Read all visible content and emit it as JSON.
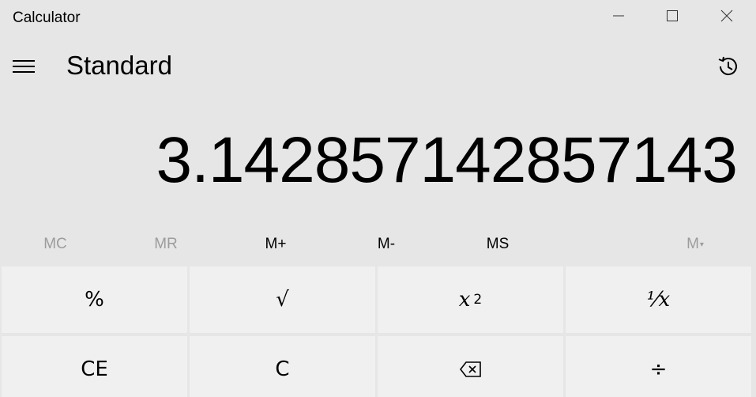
{
  "window": {
    "title": "Calculator"
  },
  "header": {
    "mode": "Standard"
  },
  "display": {
    "value": "3.142857142857143"
  },
  "memory": {
    "mc": "MC",
    "mr": "MR",
    "mplus": "M+",
    "mminus": "M-",
    "ms": "MS",
    "mlist": "M"
  },
  "keys": {
    "percent": "%",
    "sqrt": "√",
    "square_base": "x",
    "square_exp": "2",
    "reciprocal": "⅟x",
    "ce": "CE",
    "c": "C",
    "divide": "÷"
  },
  "colors": {
    "background": "#e6e6e6",
    "key": "#f0f0f0",
    "disabled_text": "#9c9c9c"
  },
  "icons": {
    "minimize": "minimize-icon",
    "maximize": "maximize-icon",
    "close": "close-icon",
    "menu": "hamburger-icon",
    "history": "history-icon",
    "backspace": "backspace-icon"
  }
}
